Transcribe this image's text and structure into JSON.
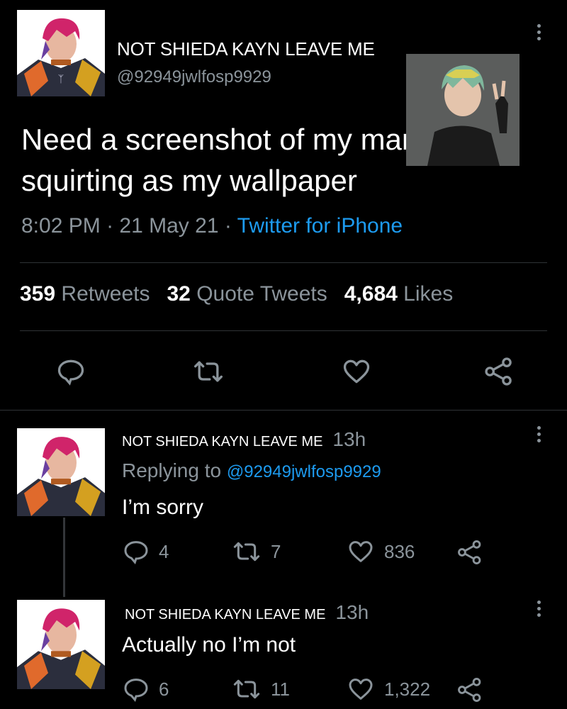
{
  "main_tweet": {
    "display_name": "NOT SHIEDA KAYN LEAVE ME",
    "handle": "@92949jwlfosp9929",
    "text": "Need a screenshot of my man squirting as my wallpaper",
    "time": "8:02 PM",
    "date": "21 May 21",
    "dot": "·",
    "source": "Twitter for iPhone",
    "stats": {
      "retweets_count": "359",
      "retweets_label": "Retweets",
      "quotes_count": "32",
      "quotes_label": "Quote Tweets",
      "likes_count": "4,684",
      "likes_label": "Likes"
    }
  },
  "replies": [
    {
      "display_name": "NOT SHIEDA KAYN LEAVE ME",
      "time": "13h",
      "replying_label": "Replying to",
      "replying_handle": "@92949jwlfosp9929",
      "text": "I’m sorry",
      "reply_count": "4",
      "retweet_count": "7",
      "like_count": "836"
    },
    {
      "display_name": "NOT SHIEDA KAYN LEAVE ME",
      "time": "13h",
      "text": "Actually no I’m not",
      "reply_count": "6",
      "retweet_count": "11",
      "like_count": "1,322"
    }
  ],
  "colors": {
    "background": "#000000",
    "text": "#ffffff",
    "secondary": "#8b949b",
    "link": "#1d9bf0",
    "divider": "#2f3336"
  },
  "icons": [
    "more-icon",
    "reply-icon",
    "retweet-icon",
    "like-icon",
    "share-icon"
  ]
}
